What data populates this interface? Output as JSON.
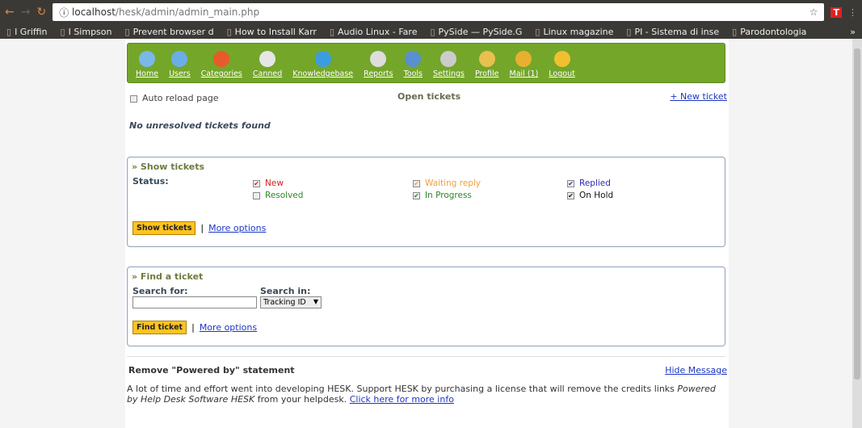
{
  "browser": {
    "url_host": "localhost",
    "url_path": "/hesk/admin/admin_main.php",
    "bookmarks": [
      "I Griffin",
      "I Simpson",
      "Prevent browser d",
      "How to Install Karr",
      "Audio Linux - Fare",
      "PySide — PySide.G",
      "Linux magazine",
      "PI - Sistema di inse",
      "Parodontologia"
    ],
    "more": "»"
  },
  "menu": [
    {
      "label": "Home",
      "icon": "home-icon",
      "color": "#7ab8e8"
    },
    {
      "label": "Users",
      "icon": "users-icon",
      "color": "#6aaee8"
    },
    {
      "label": "Categories",
      "icon": "pie-chart-icon",
      "color": "#e85a2a"
    },
    {
      "label": "Canned",
      "icon": "document-icon",
      "color": "#e6e6e6"
    },
    {
      "label": "Knowledgebase",
      "icon": "info-icon",
      "color": "#3a9de0"
    },
    {
      "label": "Reports",
      "icon": "report-icon",
      "color": "#ddd"
    },
    {
      "label": "Tools",
      "icon": "wrench-icon",
      "color": "#5a8fd0"
    },
    {
      "label": "Settings",
      "icon": "gear-icon",
      "color": "#ccc"
    },
    {
      "label": "Profile",
      "icon": "profile-icon",
      "color": "#e8c050"
    },
    {
      "label": "Mail (1)",
      "icon": "mail-icon",
      "color": "#e8b030"
    },
    {
      "label": "Logout",
      "icon": "key-icon",
      "color": "#f0c030"
    }
  ],
  "top": {
    "auto_reload": "Auto reload page",
    "title": "Open tickets",
    "new_ticket": "+ New ticket",
    "empty": "No unresolved tickets found"
  },
  "show": {
    "heading": "» Show tickets",
    "status_label": "Status:",
    "statuses": [
      {
        "label": "New",
        "checked": true,
        "color": "#d42020"
      },
      {
        "label": "Resolved",
        "checked": false,
        "color": "#2a8a2a"
      },
      {
        "label": "Waiting reply",
        "checked": true,
        "color": "#f0a040"
      },
      {
        "label": "In Progress",
        "checked": true,
        "color": "#2a8a2a"
      },
      {
        "label": "Replied",
        "checked": true,
        "color": "#2a2ab0"
      },
      {
        "label": "On Hold",
        "checked": true,
        "color": "#111"
      }
    ],
    "button": "Show tickets",
    "more": "More options",
    "sep": "|"
  },
  "find": {
    "heading": "» Find a ticket",
    "search_for": "Search for:",
    "search_in": "Search in:",
    "search_value": "",
    "select": "Tracking ID",
    "button": "Find ticket",
    "more": "More options",
    "sep": "|"
  },
  "notice": {
    "title": "Remove \"Powered by\" statement",
    "hide": "Hide Message",
    "text1": "A lot of time and effort went into developing HESK. Support HESK by purchasing a license that will remove the credits links ",
    "text_italic": "Powered by Help Desk Software HESK",
    "text2": " from your helpdesk. ",
    "link": "Click here for more info"
  }
}
